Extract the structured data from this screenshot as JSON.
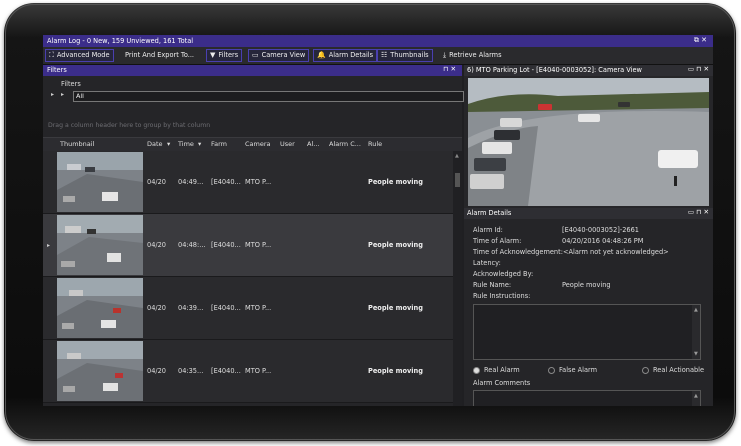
{
  "window": {
    "title": "Alarm Log - 0 New, 159 Unviewed, 161 Total",
    "controls": "⧉ ✕"
  },
  "toolbar": {
    "advanced_mode": "Advanced Mode",
    "print_export": "Print And Export To...",
    "filters": "Filters",
    "camera_view": "Camera View",
    "alarm_details": "Alarm Details",
    "thumbnails": "Thumbnails",
    "retrieve_alarms": "Retrieve Alarms"
  },
  "filters_panel": {
    "title": "Filters",
    "controls": "⊓ ✕",
    "label": "Filters",
    "value": "All",
    "drag_hint": "Drag a column header here to group by that column"
  },
  "grid": {
    "columns": [
      "Thumbnail",
      "Date",
      "Time",
      "Farm",
      "Camera",
      "User",
      "Al...",
      "Alarm C...",
      "Rule"
    ],
    "rows": [
      {
        "date": "04/20",
        "time": "04:49...",
        "farm": "[E4040...",
        "camera": "MTO P...",
        "rule": "People moving",
        "selected": false
      },
      {
        "date": "04/20",
        "time": "04:48:...",
        "farm": "[E4040...",
        "camera": "MTO P...",
        "rule": "People moving",
        "selected": true
      },
      {
        "date": "04/20",
        "time": "04:39...",
        "farm": "[E4040...",
        "camera": "MTO P...",
        "rule": "People moving",
        "selected": false
      },
      {
        "date": "04/20",
        "time": "04:35...",
        "farm": "[E4040...",
        "camera": "MTO P...",
        "rule": "People moving",
        "selected": false
      }
    ]
  },
  "camera_panel": {
    "title": "6) MTO Parking Lot - [E4040-0003052]: Camera View",
    "controls": "▭ ⊓ ✕"
  },
  "alarm_details": {
    "title": "Alarm Details",
    "controls": "▭ ⊓ ✕",
    "fields": [
      {
        "label": "Alarm Id:",
        "value": "[E4040-0003052]-2661"
      },
      {
        "label": "Time of Alarm:",
        "value": "04/20/2016 04:48:26 PM"
      },
      {
        "label": "Time of Acknowledgement:",
        "value": "<Alarm not yet acknowledged>"
      },
      {
        "label": "Latency:",
        "value": ""
      },
      {
        "label": "Acknowledged By:",
        "value": ""
      },
      {
        "label": "Rule Name:",
        "value": "People moving"
      },
      {
        "label": "Rule Instructions:",
        "value": ""
      }
    ],
    "radio_real": "Real Alarm",
    "radio_false": "False Alarm",
    "radio_actionable": "Real Actionable",
    "comments_label": "Alarm Comments"
  },
  "colors": {
    "accent": "#3b2d8a",
    "panel_bg": "#252528"
  }
}
